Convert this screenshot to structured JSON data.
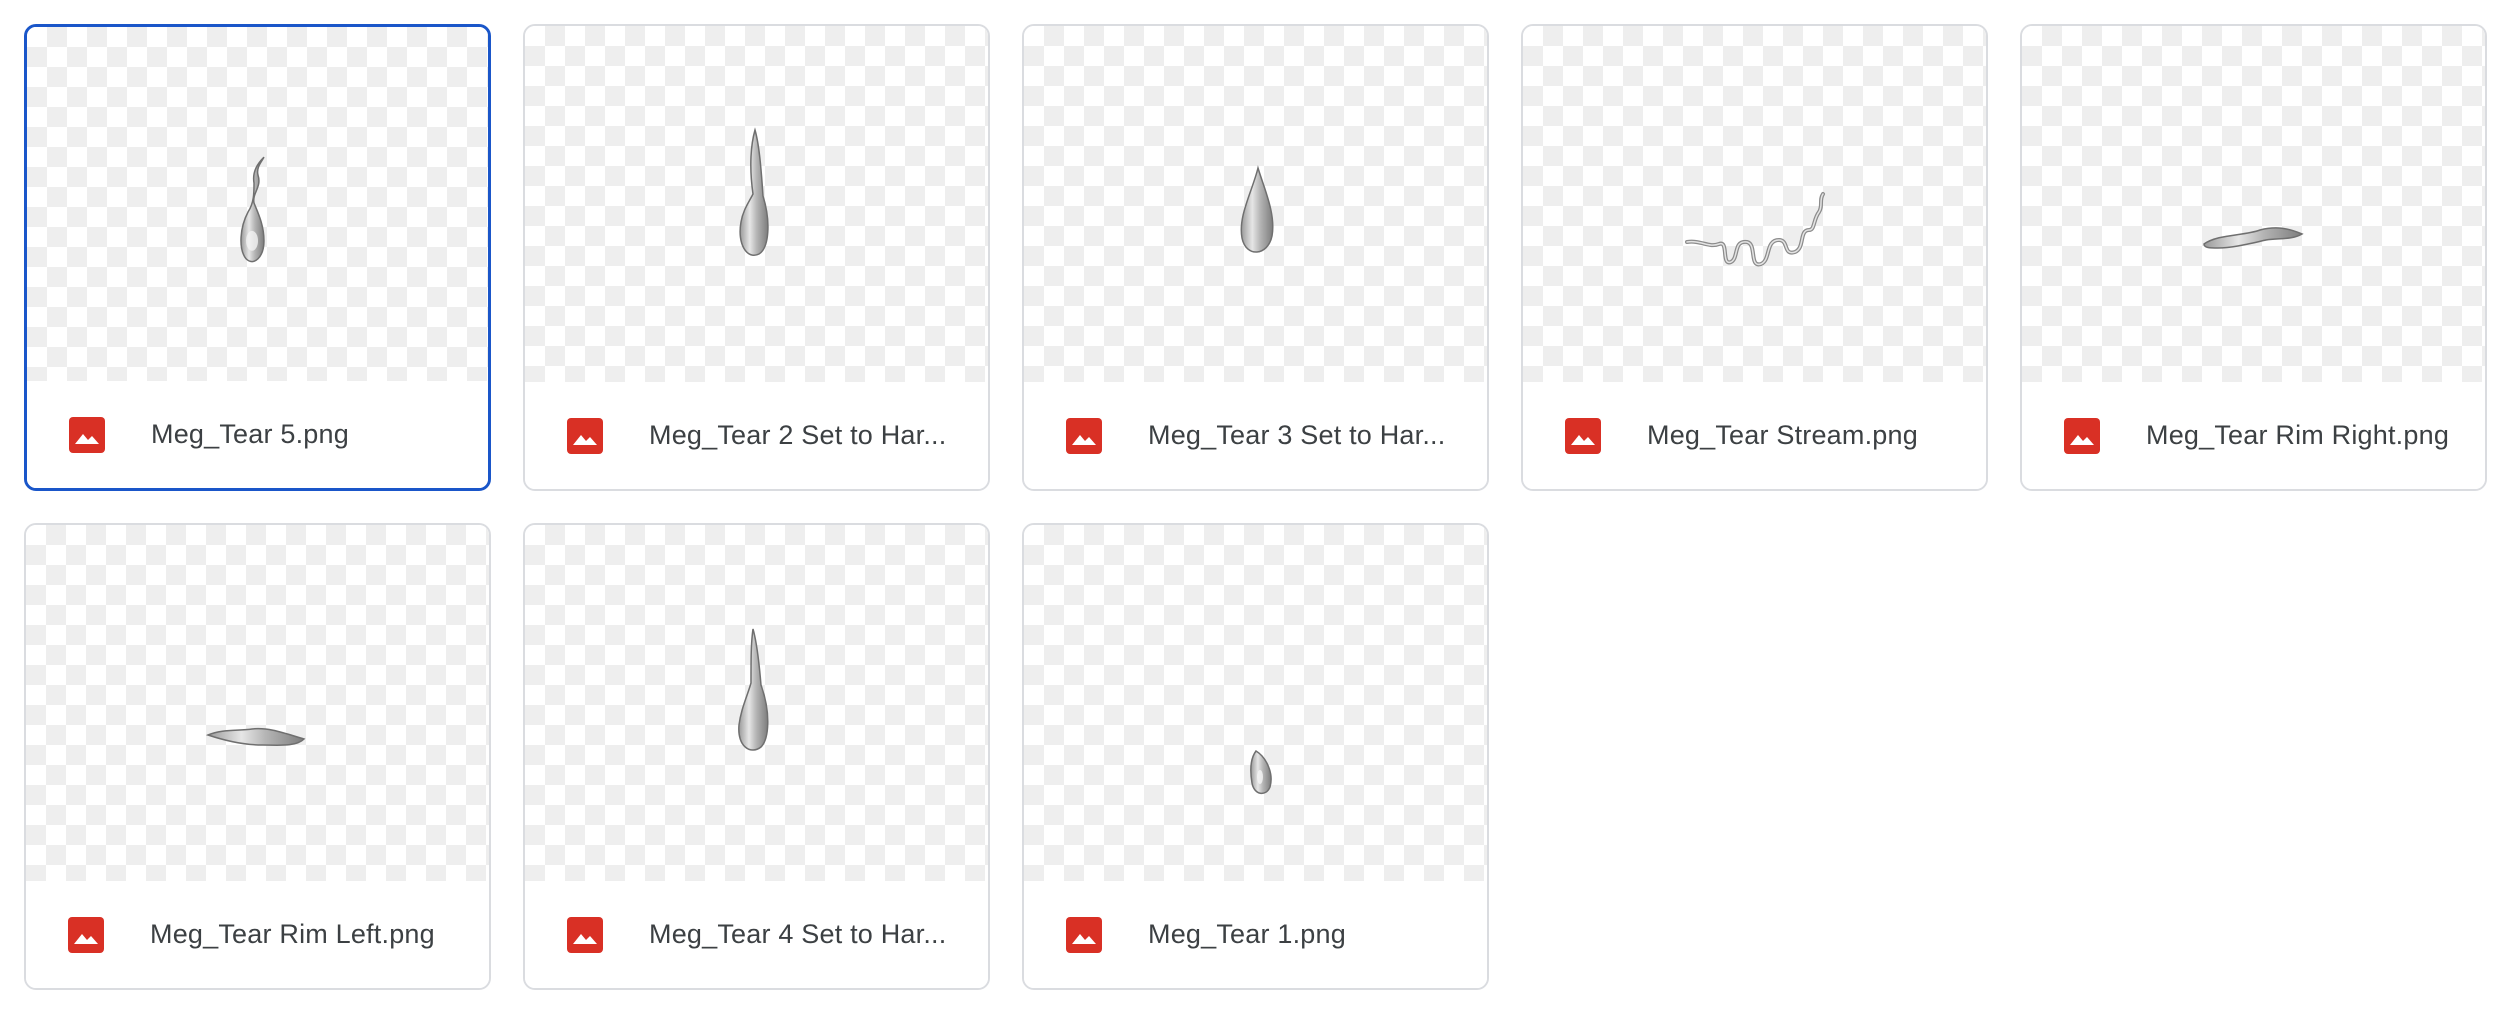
{
  "colors": {
    "selected_border": "#1a56c9",
    "tile_border": "#dadce0",
    "file_icon": "#d93025",
    "file_name_text": "#3c4043",
    "checker": "#eeeeee"
  },
  "files": [
    {
      "name": "Meg_Tear 5.png",
      "icon": "image-file-icon",
      "selected": true
    },
    {
      "name": "Meg_Tear 2 Set to Har...",
      "icon": "image-file-icon",
      "selected": false
    },
    {
      "name": "Meg_Tear 3 Set to Har...",
      "icon": "image-file-icon",
      "selected": false
    },
    {
      "name": "Meg_Tear Stream.png",
      "icon": "image-file-icon",
      "selected": false
    },
    {
      "name": "Meg_Tear Rim Right.png",
      "icon": "image-file-icon",
      "selected": false
    },
    {
      "name": "Meg_Tear Rim Left.png",
      "icon": "image-file-icon",
      "selected": false
    },
    {
      "name": "Meg_Tear 4 Set to Har...",
      "icon": "image-file-icon",
      "selected": false
    },
    {
      "name": "Meg_Tear 1.png",
      "icon": "image-file-icon",
      "selected": false
    }
  ]
}
